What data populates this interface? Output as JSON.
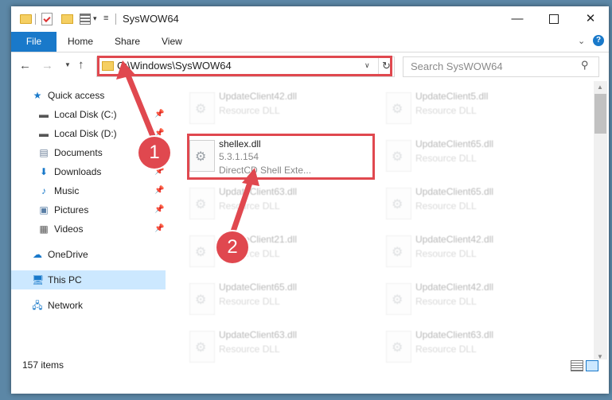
{
  "window": {
    "title": "SysWOW64"
  },
  "ribbon": {
    "file": "File",
    "home": "Home",
    "share": "Share",
    "view": "View"
  },
  "address": {
    "path": "C:\\Windows\\SysWOW64"
  },
  "search": {
    "placeholder": "Search SysWOW64"
  },
  "sidebar": {
    "items": [
      {
        "label": "Quick access"
      },
      {
        "label": "Local Disk (C:)"
      },
      {
        "label": "Local Disk (D:)"
      },
      {
        "label": "Documents"
      },
      {
        "label": "Downloads"
      },
      {
        "label": "Music"
      },
      {
        "label": "Pictures"
      },
      {
        "label": "Videos"
      },
      {
        "label": "OneDrive"
      },
      {
        "label": "This PC"
      },
      {
        "label": "Network"
      }
    ]
  },
  "files": {
    "shellex": {
      "name": "shellex.dll",
      "version": "5.3.1.154",
      "desc": "DirectCD Shell Exte..."
    },
    "tiles": [
      {
        "name": "UpdateClient42.dll",
        "type": "Resource DLL"
      },
      {
        "name": "UpdateClient5.dll",
        "type": "Resource DLL"
      },
      {
        "name": "UpdateClient65.dll",
        "type": "Resource DLL"
      },
      {
        "name": "UpdateClient63.dll",
        "type": "Resource DLL"
      },
      {
        "name": "UpdateClient65.dll",
        "type": "Resource DLL"
      },
      {
        "name": "UpdateClient21.dll",
        "type": "Resource DLL"
      },
      {
        "name": "UpdateClient42.dll",
        "type": "Resource DLL"
      },
      {
        "name": "UpdateClient65.dll",
        "type": "Resource DLL"
      },
      {
        "name": "UpdateClient42.dll",
        "type": "Resource DLL"
      },
      {
        "name": "UpdateClient63.dll",
        "type": "Resource DLL"
      },
      {
        "name": "UpdateClient63.dll",
        "type": "Resource DLL"
      }
    ]
  },
  "status": {
    "items": "157 items"
  },
  "callouts": {
    "one": "1",
    "two": "2"
  },
  "colors": {
    "accent": "#1979ca",
    "highlight": "#e0484f",
    "selected": "#cce8ff"
  }
}
